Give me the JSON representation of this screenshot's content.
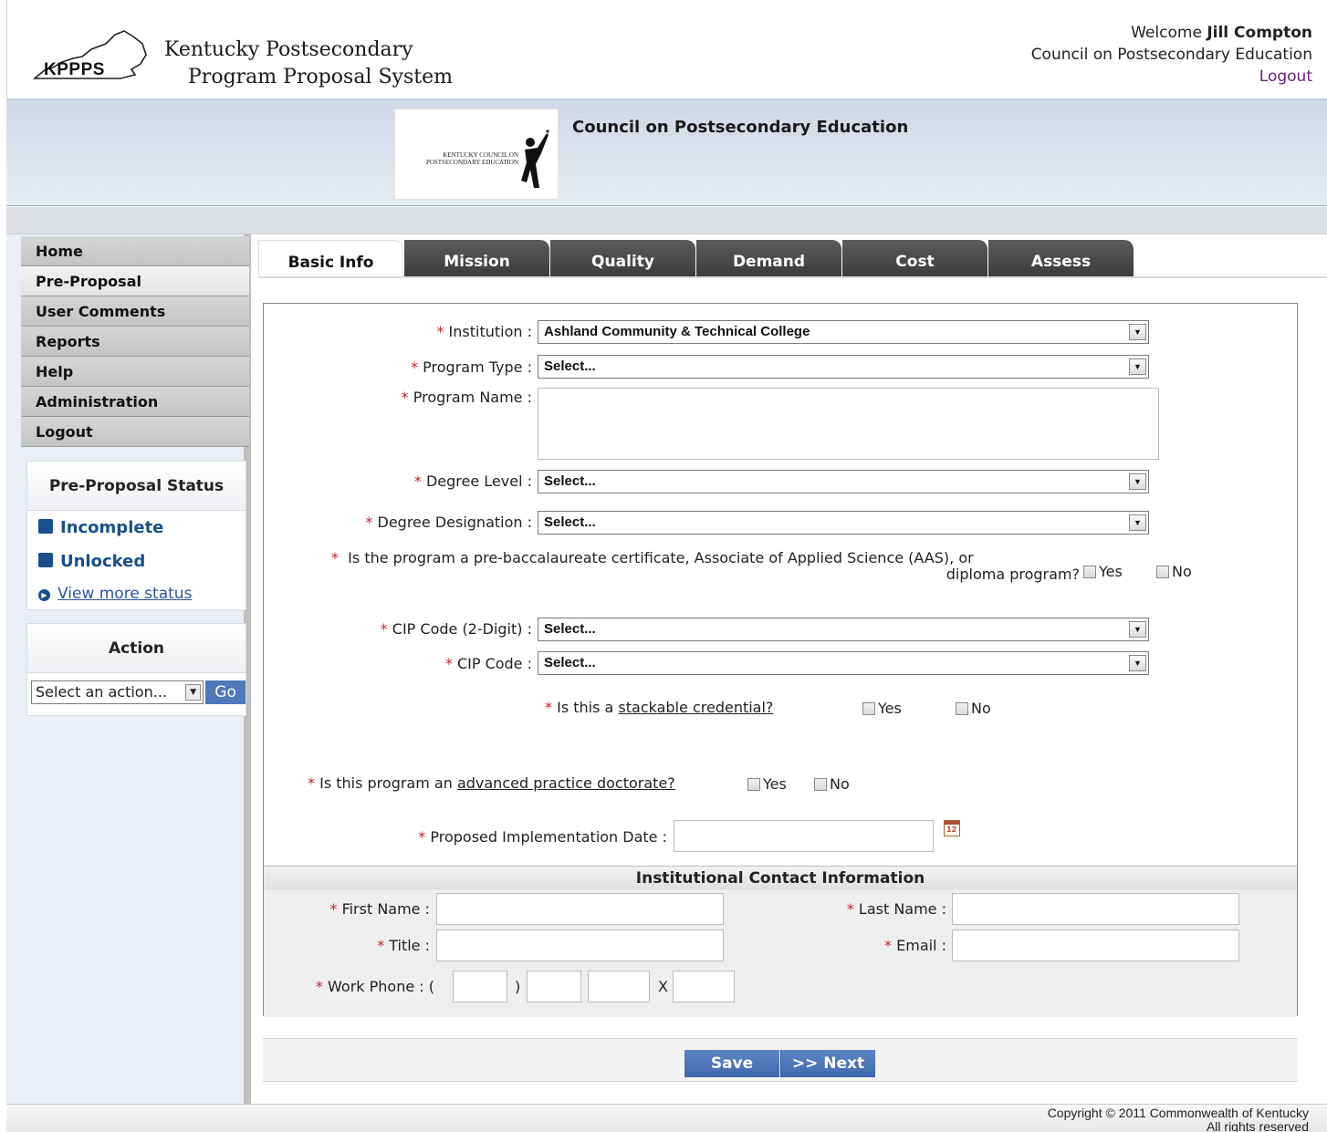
{
  "header": {
    "logo_text": "KPPPS",
    "title_line1": "Kentucky Postsecondary",
    "title_line2": "Program Proposal System",
    "welcome_prefix": "Welcome",
    "user_name": "Jill Compton",
    "organization": "Council on Postsecondary Education",
    "logout_label": "Logout"
  },
  "banner": {
    "logo_line1": "KENTUCKY COUNCIL ON",
    "logo_line2": "POSTSECONDARY EDUCATION",
    "title": "Council on Postsecondary Education"
  },
  "sidebar": {
    "items": [
      {
        "label": "Home",
        "active": false
      },
      {
        "label": "Pre-Proposal",
        "active": true
      },
      {
        "label": "User Comments",
        "active": false
      },
      {
        "label": "Reports",
        "active": false
      },
      {
        "label": "Help",
        "active": false
      },
      {
        "label": "Administration",
        "active": false
      },
      {
        "label": "Logout",
        "active": false
      }
    ],
    "status": {
      "title": "Pre-Proposal Status",
      "state": "Incomplete",
      "lock": "Unlocked",
      "more_link": "View more status"
    },
    "action": {
      "title": "Action",
      "select_value": "Select an action...",
      "go_label": "Go"
    }
  },
  "tabs": [
    "Basic Info",
    "Mission",
    "Quality",
    "Demand",
    "Cost",
    "Assess"
  ],
  "form": {
    "required_mark": "*",
    "institution": {
      "label": "Institution :",
      "value": "Ashland Community & Technical College"
    },
    "program_type": {
      "label": "Program Type :",
      "value": "Select..."
    },
    "program_name": {
      "label": "Program Name :",
      "value": ""
    },
    "degree_level": {
      "label": "Degree Level :",
      "value": "Select..."
    },
    "degree_designation": {
      "label": "Degree Designation :",
      "value": "Select..."
    },
    "aas_question": {
      "line1": "Is the program a pre-baccalaureate certificate, Associate of Applied Science (AAS), or",
      "line2": "diploma program?"
    },
    "cip2": {
      "label": "CIP Code (2-Digit) :",
      "value": "Select..."
    },
    "cip": {
      "label": "CIP Code :",
      "value": "Select..."
    },
    "stackable": {
      "prefix": "Is this a",
      "link": "stackable credential?"
    },
    "doctorate": {
      "prefix": "Is this program an",
      "link": "advanced practice doctorate?"
    },
    "yes_label": "Yes",
    "no_label": "No",
    "implementation_date": {
      "label": "Proposed Implementation Date :",
      "value": "",
      "icon_text": "12"
    }
  },
  "contact": {
    "title": "Institutional Contact Information",
    "first_name": "First Name :",
    "last_name": "Last Name :",
    "title_field": "Title :",
    "email": "Email :",
    "work_phone": "Work Phone :",
    "paren_open": "(",
    "paren_close": ")",
    "ext": "X"
  },
  "buttons": {
    "save": "Save",
    "next": ">> Next"
  },
  "footer": {
    "line1": "Copyright © 2011 Commonwealth of Kentucky",
    "line2": "All rights reserved"
  }
}
